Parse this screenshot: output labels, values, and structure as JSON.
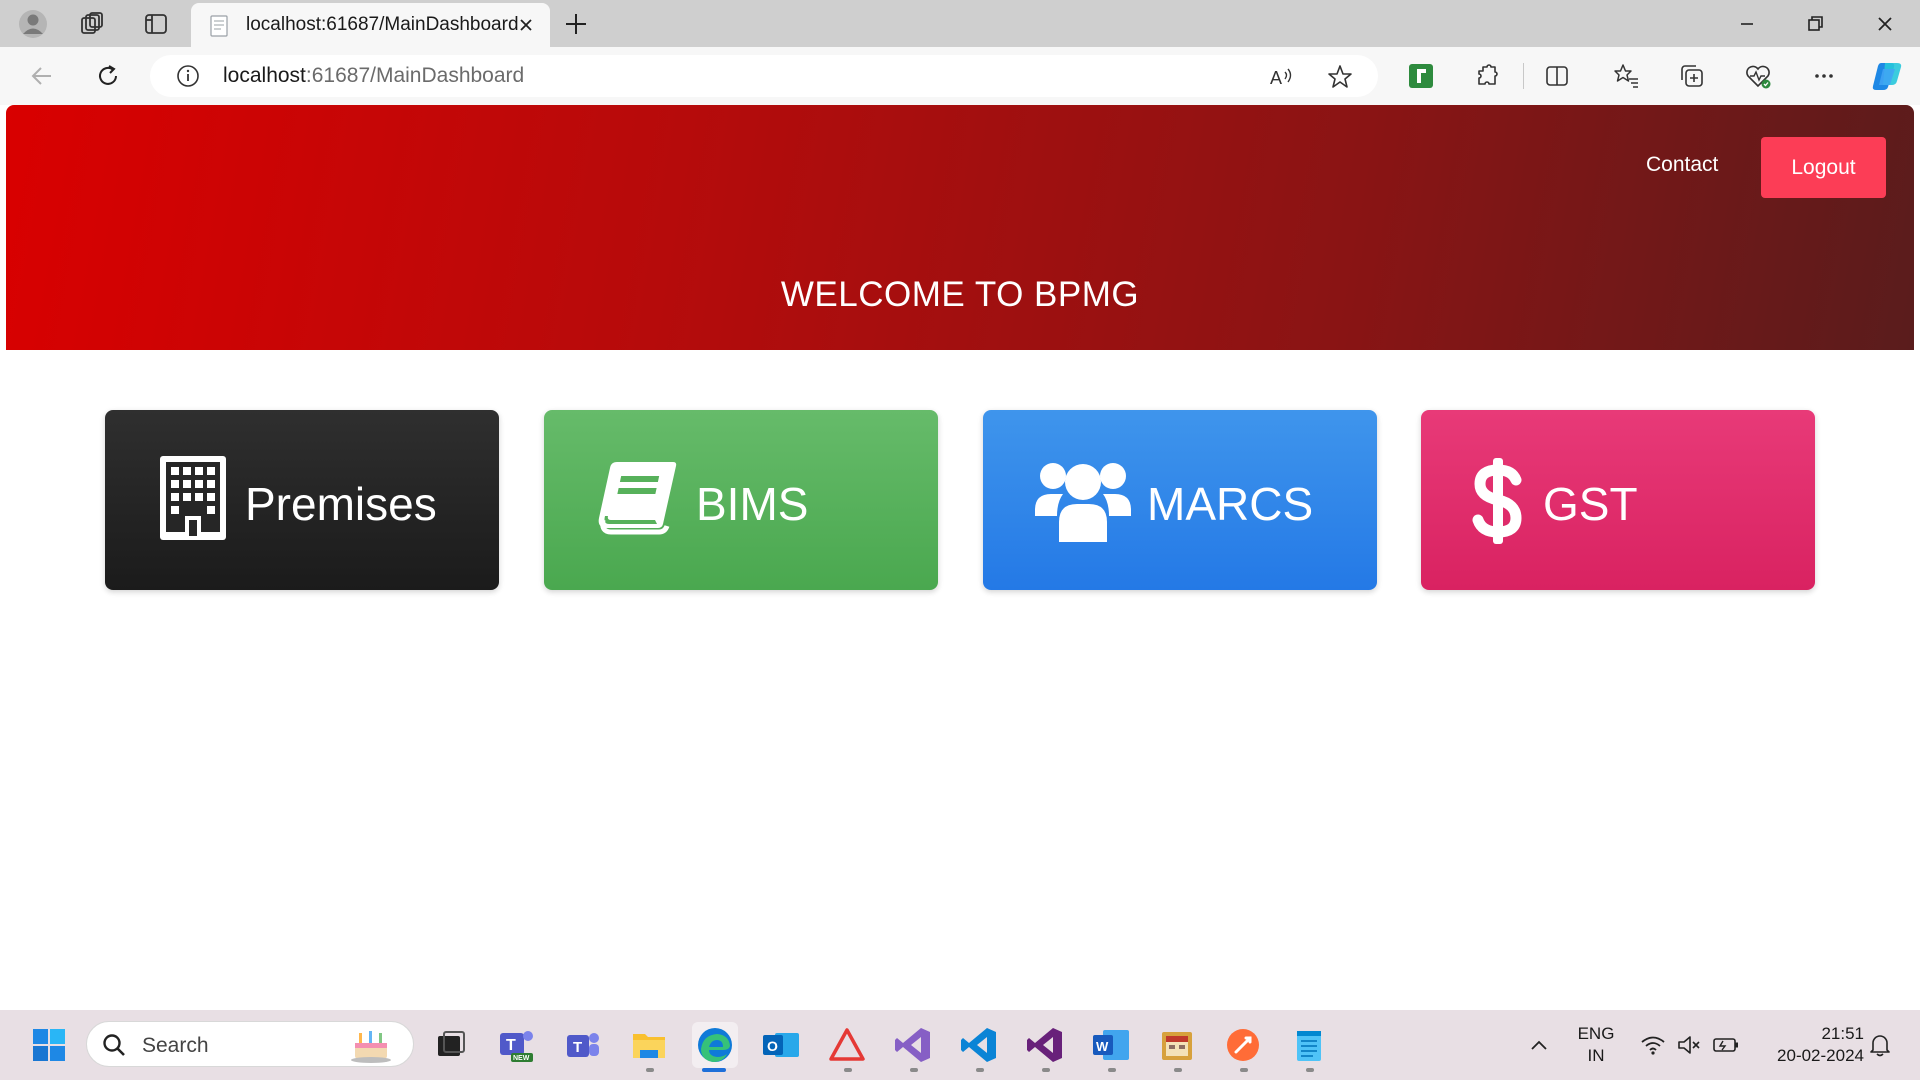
{
  "browser": {
    "tab_title": "localhost:61687/MainDashboard",
    "url_host": "localhost",
    "url_rest": ":61687/MainDashboard",
    "icons": [
      "profile-icon",
      "workspaces-icon",
      "tab-actions-icon",
      "close-tab-icon",
      "new-tab-icon",
      "minimize-icon",
      "restore-icon",
      "close-window-icon",
      "back-icon",
      "refresh-icon",
      "site-info-icon",
      "read-aloud-icon",
      "favorite-star-icon",
      "extension-icon",
      "extensions-icon",
      "split-screen-icon",
      "favorites-icon",
      "collections-icon",
      "browser-essentials-icon",
      "more-icon",
      "copilot-icon"
    ]
  },
  "page": {
    "nav": {
      "contact_label": "Contact",
      "logout_label": "Logout"
    },
    "hero_title": "WELCOME TO BPMG",
    "cards": [
      {
        "label": "Premises",
        "icon": "building-icon",
        "color": "#262626"
      },
      {
        "label": "BIMS",
        "icon": "book-icon",
        "color": "#57b15b"
      },
      {
        "label": "MARCS",
        "icon": "users-icon",
        "color": "#2f86ea"
      },
      {
        "label": "GST",
        "icon": "dollar-icon",
        "color": "#e0306c"
      }
    ],
    "colors": {
      "hero_start": "#d90000",
      "hero_end": "#5a1c1c",
      "logout": "#fc3d56"
    }
  },
  "taskbar": {
    "search_placeholder": "Search",
    "apps": [
      "start-icon",
      "task-view-icon",
      "teams-new-icon",
      "teams-icon",
      "file-explorer-icon",
      "edge-icon",
      "outlook-icon",
      "warning-app-icon",
      "visual-studio-icon",
      "vscode-icon",
      "visual-studio-2-icon",
      "word-icon",
      "calendar-app-icon",
      "postman-icon",
      "notepad-icon"
    ],
    "language_line1": "ENG",
    "language_line2": "IN",
    "time": "21:51",
    "date": "20-02-2024"
  }
}
